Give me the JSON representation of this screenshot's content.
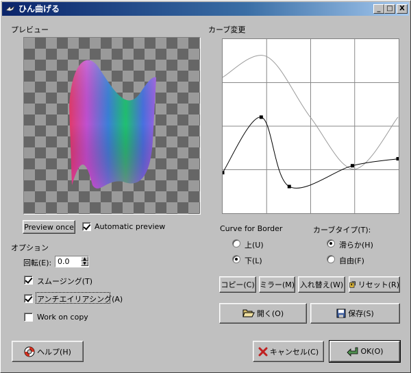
{
  "window": {
    "title": "ひん曲げる"
  },
  "titlebar_buttons": {
    "minimize": "_",
    "maximize": "□",
    "close": "X"
  },
  "preview": {
    "heading": "プレビュー",
    "preview_once_label": "Preview once",
    "automatic_preview_label": "Automatic preview",
    "automatic_preview_checked": true
  },
  "options": {
    "heading": "オプション",
    "rotate_label": "回転(E):",
    "rotate_value": "0.0",
    "smoothing_label": "スムージング(T)",
    "smoothing_checked": true,
    "antialias_label": "アンチエイリアシング(A)",
    "antialias_checked": true,
    "work_on_copy_label": "Work on copy",
    "work_on_copy_checked": false
  },
  "curve": {
    "heading": "カーブ変更",
    "border_label": "Curve for Border",
    "border_upper": "上(U)",
    "border_lower": "下(L)",
    "border_selected": "lower",
    "type_label": "カーブタイプ(T):",
    "type_smooth": "滑らか(H)",
    "type_free": "自由(F)",
    "type_selected": "smooth",
    "upper_curve": [
      [
        0,
        0.78
      ],
      [
        0.25,
        0.9
      ],
      [
        0.5,
        0.55
      ],
      [
        0.75,
        0.25
      ],
      [
        1,
        0.55
      ]
    ],
    "lower_curve": [
      [
        0,
        0.23
      ],
      [
        0.22,
        0.55
      ],
      [
        0.38,
        0.15
      ],
      [
        0.74,
        0.27
      ],
      [
        1,
        0.31
      ]
    ]
  },
  "buttons": {
    "copy": "コピー(C)",
    "mirror": "ミラー(M)",
    "swap": "入れ替え(W)",
    "reset": "リセット(R)",
    "open": "開く(O)",
    "save": "保存(S)",
    "help": "ヘルプ(H)",
    "cancel": "キャンセル(C)",
    "ok": "OK(O)"
  },
  "colors": {
    "title_start": "#0a246a",
    "title_end": "#a6caf0",
    "face": "#c0c0c0"
  }
}
